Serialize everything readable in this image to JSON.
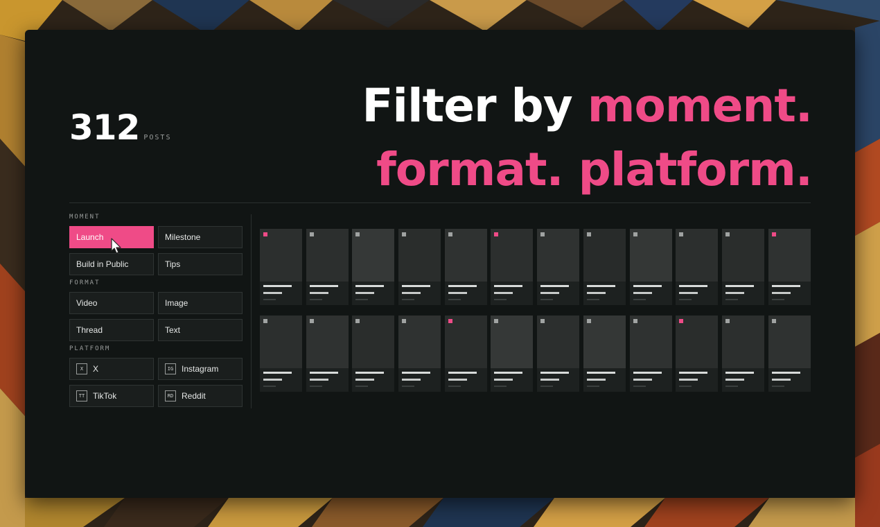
{
  "stats": {
    "count": "312",
    "unit": "POSTS"
  },
  "headline": {
    "line1_white": "Filter by ",
    "line1_pink": "moment.",
    "line2_pink": "format. platform."
  },
  "colors": {
    "accent": "#ef4b87",
    "panel": "#111514",
    "button": "#1a1e1d"
  },
  "filters": {
    "moment": {
      "label": "MOMENT",
      "options": [
        "Launch",
        "Milestone",
        "Build in Public",
        "Tips"
      ],
      "selected": "Launch"
    },
    "format": {
      "label": "FORMAT",
      "options": [
        "Video",
        "Image",
        "Thread",
        "Text"
      ]
    },
    "platform": {
      "label": "PLATFORM",
      "options": [
        {
          "label": "X",
          "icon": "X"
        },
        {
          "label": "Instagram",
          "icon": "IG"
        },
        {
          "label": "TikTok",
          "icon": "TT"
        },
        {
          "label": "Reddit",
          "icon": "RD"
        }
      ]
    }
  },
  "posts": [
    {
      "tag": "pink",
      "shade": "#2c2f2e"
    },
    {
      "tag": "gray",
      "shade": "#2c2f2e"
    },
    {
      "tag": "gray",
      "shade": "#353837"
    },
    {
      "tag": "gray",
      "shade": "#2a2d2c"
    },
    {
      "tag": "gray",
      "shade": "#2f3231"
    },
    {
      "tag": "pink",
      "shade": "#2c2f2e"
    },
    {
      "tag": "gray",
      "shade": "#2f3231"
    },
    {
      "tag": "gray",
      "shade": "#282b2a"
    },
    {
      "tag": "gray",
      "shade": "#343736"
    },
    {
      "tag": "gray",
      "shade": "#2c2f2e"
    },
    {
      "tag": "gray",
      "shade": "#2a2d2c"
    },
    {
      "tag": "pink",
      "shade": "#2f3231"
    },
    {
      "tag": "gray",
      "shade": "#2c2f2e"
    },
    {
      "tag": "gray",
      "shade": "#2f3231"
    },
    {
      "tag": "gray",
      "shade": "#2a2d2c"
    },
    {
      "tag": "gray",
      "shade": "#2f3231"
    },
    {
      "tag": "pink",
      "shade": "#2a2d2c"
    },
    {
      "tag": "gray",
      "shade": "#353837"
    },
    {
      "tag": "gray",
      "shade": "#2c2f2e"
    },
    {
      "tag": "gray",
      "shade": "#343736"
    },
    {
      "tag": "gray",
      "shade": "#2f3231"
    },
    {
      "tag": "pink",
      "shade": "#2a2d2c"
    },
    {
      "tag": "gray",
      "shade": "#2c2f2e"
    },
    {
      "tag": "gray",
      "shade": "#2f3231"
    }
  ]
}
